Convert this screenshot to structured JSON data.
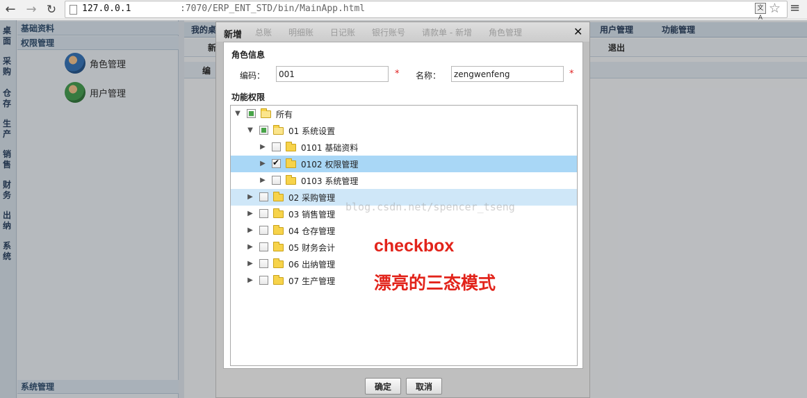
{
  "browser": {
    "back": "←",
    "forward": "→",
    "reload": "↻",
    "url_host": "127.0.0.1",
    "url_path": ":7070/ERP_ENT_STD/bin/MainApp.html",
    "translate": "文A",
    "star": "☆",
    "menu": "≡"
  },
  "left_rail": [
    "桌面",
    "采购",
    "仓存",
    "生产",
    "销售",
    "财务",
    "出纳",
    "系统"
  ],
  "side_panel": {
    "section_basic": "基础资料",
    "section_perm": "权限管理",
    "items": [
      {
        "label": "角色管理",
        "icon": "role-avatar-icon"
      },
      {
        "label": "用户管理",
        "icon": "user-avatar-icon"
      }
    ],
    "section_system": "系统管理"
  },
  "main": {
    "tabs": [
      "我的桌",
      "用户管理",
      "功能管理"
    ],
    "toolbar": [
      "新",
      "退出"
    ],
    "subtab": "编"
  },
  "dialog": {
    "title": "新增",
    "ghost_tabs": "总账　　明细账　　日记账　　银行账号　　请款单 - 新增　　角色管理",
    "close": "✕",
    "role_info_title": "角色信息",
    "code_label": "编码：",
    "code_value": "001",
    "name_label": "名称：",
    "name_value": "zengwenfeng",
    "required_mark": "*",
    "perm_title": "功能权限",
    "tree": [
      {
        "label": "所有",
        "level": 0,
        "state": "partial",
        "expand": "expanded",
        "selected": false
      },
      {
        "label": "01 系统设置",
        "level": 1,
        "state": "partial",
        "expand": "expanded",
        "selected": false
      },
      {
        "label": "0101 基础资料",
        "level": 2,
        "state": "unchecked",
        "expand": "collapsed",
        "selected": false
      },
      {
        "label": "0102 权限管理",
        "level": 2,
        "state": "checked",
        "expand": "collapsed",
        "selected": true
      },
      {
        "label": "0103 系统管理",
        "level": 2,
        "state": "unchecked",
        "expand": "collapsed",
        "selected": false
      },
      {
        "label": "02 采购管理",
        "level": 1,
        "state": "unchecked",
        "expand": "collapsed",
        "selected": false,
        "hover": true
      },
      {
        "label": "03 销售管理",
        "level": 1,
        "state": "unchecked",
        "expand": "collapsed",
        "selected": false
      },
      {
        "label": "04 仓存管理",
        "level": 1,
        "state": "unchecked",
        "expand": "collapsed",
        "selected": false
      },
      {
        "label": "05 财务会计",
        "level": 1,
        "state": "unchecked",
        "expand": "collapsed",
        "selected": false
      },
      {
        "label": "06 出纳管理",
        "level": 1,
        "state": "unchecked",
        "expand": "collapsed",
        "selected": false
      },
      {
        "label": "07 生产管理",
        "level": 1,
        "state": "unchecked",
        "expand": "collapsed",
        "selected": false
      }
    ],
    "watermark": "blog.csdn.net/spencer_tseng",
    "annotation_1": "checkbox",
    "annotation_2": "漂亮的三态模式",
    "ok_label": "确定",
    "cancel_label": "取消"
  },
  "colors": {
    "selected_row": "#a9d7f6",
    "hover_row": "#cfe7f8",
    "annotation": "#e2231a",
    "partial_check": "#49a449",
    "required": "#e02020"
  }
}
